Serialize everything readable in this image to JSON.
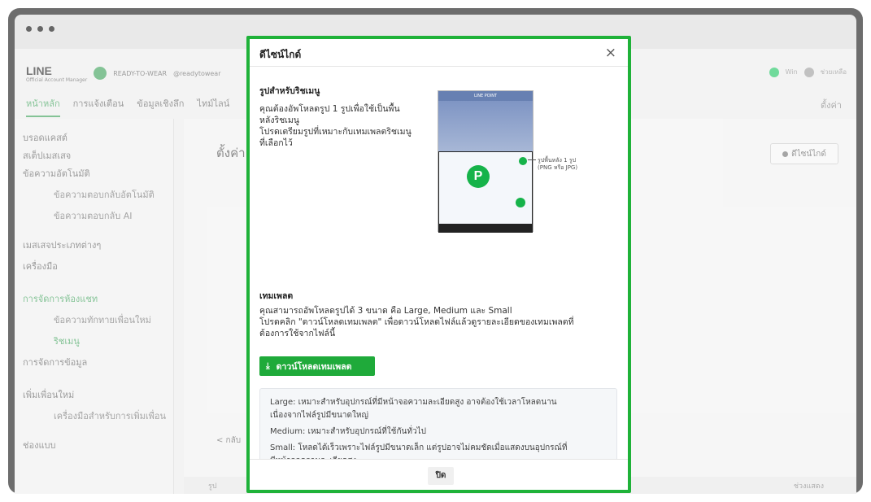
{
  "app": {
    "logo": "LINE",
    "logo_sub": "Official Account Manager",
    "account_name": "READY-TO-WEAR",
    "account_id": "@readytowear",
    "top_right_1": "Win",
    "top_right_2": "ช่วยเหลือ",
    "settings": "ตั้งค่า",
    "tabs": [
      "หน้าหลัก",
      "การแจ้งเตือน",
      "ข้อมูลเชิงลึก",
      "ไทม์ไลน์"
    ],
    "page_title": "ตั้งค่า",
    "design_button": "ดีไซน์ไกด์",
    "back": "< กลับ",
    "bottom_left": "รูป",
    "bottom_right": "ช่วงแสดง"
  },
  "sidebar": {
    "items": [
      {
        "label": "บรอดแคสต์",
        "sub": false
      },
      {
        "label": "สเต็ปเมสเสจ",
        "sub": false
      },
      {
        "label": "ข้อความอัตโนมัติ",
        "sub": false
      },
      {
        "label": "ข้อความตอบกลับอัตโนมัติ",
        "sub": true
      },
      {
        "label": "ข้อความตอบกลับ AI",
        "sub": true
      },
      {
        "label": "เมสเสจประเภทต่างๆ",
        "sub": false
      },
      {
        "label": "เครื่องมือ",
        "sub": false
      },
      {
        "label": "การจัดการห้องแชท",
        "sub": false
      },
      {
        "label": "ข้อความทักทายเพื่อนใหม่",
        "sub": true
      },
      {
        "label": "ริชเมนู",
        "sub": true
      },
      {
        "label": "การจัดการข้อมูล",
        "sub": false
      },
      {
        "label": "เพิ่มเพื่อนใหม่",
        "sub": false
      },
      {
        "label": "เครื่องมือสำหรับการเพิ่มเพื่อน",
        "sub": true
      },
      {
        "label": "ช่องแบบ",
        "sub": false
      }
    ]
  },
  "modal": {
    "title": "ดีไซน์ไกด์",
    "section1_title": "รูปสำหรับริชเมนู",
    "section1_line1": "คุณต้องอัพโหลดรูป 1 รูปเพื่อใช้เป็นพื้น",
    "section1_line2": "หลังริชเมนู",
    "section1_line3": "โปรดเตรียมรูปที่เหมาะกับเทมเพลตริชเมนู",
    "section1_line4": "ที่เลือกไว้",
    "preview_header": "LINE POINT",
    "preview_note_1": "รูปพื้นหลัง 1 รูป",
    "preview_note_2": "(PNG หรือ JPG)",
    "preview_coin": "P",
    "section2_title": "เทมเพลต",
    "section2_line1": "คุณสามารถอัพโหลดรูปได้ 3 ขนาด คือ Large, Medium และ Small",
    "section2_line2": "โปรดคลิก \"ดาวน์โหลดเทมเพลต\" เพื่อดาวน์โหลดไฟล์แล้วดูรายละเอียดของเทมเพลตที่",
    "section2_line3": "ต้องการใช้จากไฟล์นี้",
    "download_label": "ดาวน์โหลดเทมเพลต",
    "info_large_1": "Large: เหมาะสำหรับอุปกรณ์ที่มีหน้าจอความละเอียดสูง อาจต้องใช้เวลาโหลดนาน",
    "info_large_2": "เนื่องจากไฟล์รูปมีขนาดใหญ่",
    "info_medium": "Medium: เหมาะสำหรับอุปกรณ์ที่ใช้กันทั่วไป",
    "info_small_1": "Small: โหลดได้เร็วเพราะไฟล์รูปมีขนาดเล็ก แต่รูปอาจไม่คมชัดเมื่อแสดงบนอุปกรณ์ที่",
    "info_small_2": "มีหน้าจอความละเอียดสูง",
    "close_label": "ปิด"
  },
  "colors": {
    "accent": "#1fb239",
    "brand": "#06c755"
  }
}
